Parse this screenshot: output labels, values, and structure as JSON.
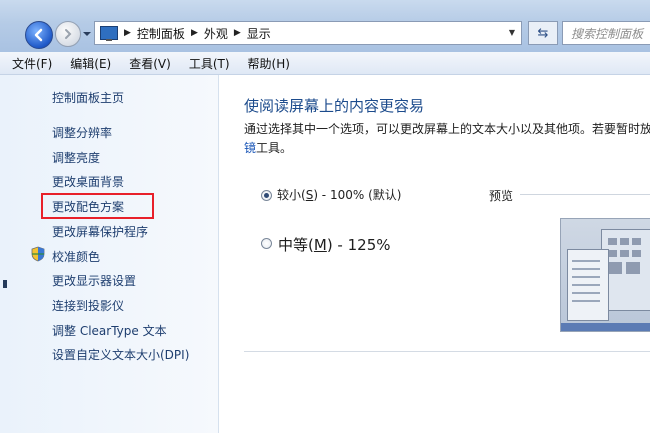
{
  "titlebar": {
    "breadcrumbs": [
      "控制面板",
      "外观",
      "显示"
    ],
    "search_placeholder": "搜索控制面板"
  },
  "menu": [
    "文件(F)",
    "编辑(E)",
    "查看(V)",
    "工具(T)",
    "帮助(H)"
  ],
  "sidebar": {
    "home": "控制面板主页",
    "items": [
      "调整分辨率",
      "调整亮度",
      "更改桌面背景",
      "更改配色方案",
      "更改屏幕保护程序",
      "校准颜色",
      "更改显示器设置",
      "连接到投影仪",
      "调整 ClearType 文本",
      "设置自定义文本大小(DPI)"
    ],
    "highlighted_item": "更改配色方案",
    "highlight_color": "#e8202a"
  },
  "main": {
    "title": "使阅读屏幕上的内容更容易",
    "description": "通过选择其中一个选项，可以更改屏幕上的文本大小以及其他项。若要暂时放大",
    "description_line2_link": "镜",
    "description_line2_rest": "工具。",
    "options": [
      {
        "label_prefix": "较小(",
        "mnemonic": "S",
        "label_suffix": ") - 100% (默认)",
        "selected": true
      },
      {
        "label_prefix": "中等(",
        "mnemonic": "M",
        "label_suffix": ") - 125%",
        "selected": false
      }
    ],
    "preview_label": "预览"
  },
  "colors": {
    "title_blue": "#1c4b8c",
    "link_blue": "#1e3e6f"
  }
}
